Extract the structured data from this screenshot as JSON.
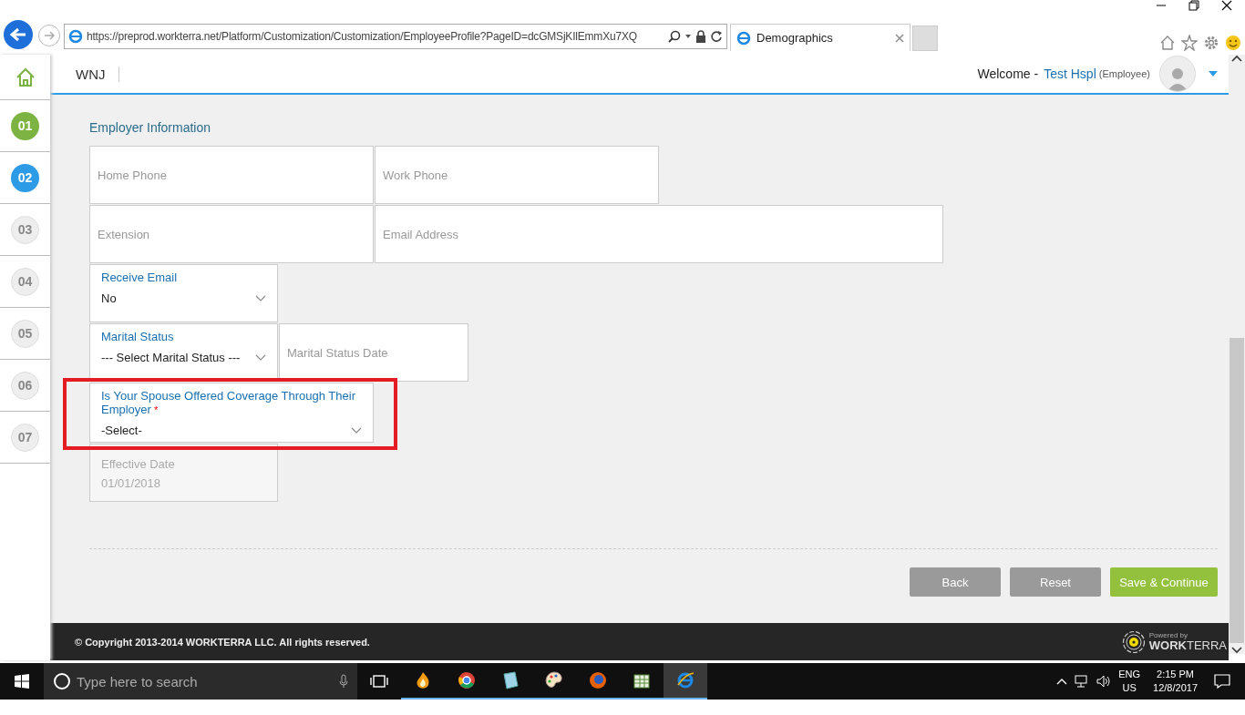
{
  "browser": {
    "address": "https://preprod.workterra.net/Platform/Customization/Customization/EmployeeProfile?PageID=dcGMSjKIlEmmXu7XQ",
    "tab_title": "Demographics"
  },
  "header": {
    "brand": "WNJ",
    "welcome": "Welcome -",
    "user": "Test Hspl",
    "role": "(Employee)"
  },
  "steps": [
    {
      "label": "01",
      "completed": true,
      "selected": false
    },
    {
      "label": "02",
      "completed": false,
      "selected": true
    },
    {
      "label": "03",
      "completed": false,
      "selected": false
    },
    {
      "label": "04",
      "completed": false,
      "selected": false
    },
    {
      "label": "05",
      "completed": false,
      "selected": false
    },
    {
      "label": "06",
      "completed": false,
      "selected": false
    },
    {
      "label": "07",
      "completed": false,
      "selected": false
    }
  ],
  "section_title": "Employer Information",
  "rows": [
    [
      {
        "kind": "input",
        "placeholder": "Home Phone"
      },
      {
        "kind": "input",
        "placeholder": "Work Phone"
      }
    ],
    [
      {
        "kind": "input",
        "placeholder": "Extension"
      },
      {
        "kind": "input",
        "placeholder": "Email Address"
      }
    ],
    [
      {
        "kind": "select",
        "label": "Receive Email",
        "value": "No"
      }
    ],
    [
      {
        "kind": "select",
        "label": "Marital Status",
        "value": "--- Select Marital Status ---"
      },
      {
        "kind": "input",
        "placeholder": "Marital Status Date"
      }
    ],
    [
      {
        "kind": "select",
        "label": "Is Your Spouse Offered Coverage Through Their Employer",
        "required_mark": "*",
        "value": "-Select-",
        "highlighted": true
      }
    ],
    [
      {
        "kind": "readonly",
        "label": "Effective Date",
        "value": "01/01/2018",
        "disabled": true
      }
    ]
  ],
  "buttons": [
    {
      "label": "Back",
      "kind": "secondary"
    },
    {
      "label": "Reset",
      "kind": "secondary"
    },
    {
      "label": "Save & Continue",
      "kind": "primary"
    }
  ],
  "footer": {
    "copyright": "© Copyright 2013-2014 WORKTERRA LLC. All rights reserved.",
    "powered_by": "Powered by",
    "brand_bold": "WORK",
    "brand_light": "TERRA"
  },
  "taskbar": {
    "search_placeholder": "Type here to search",
    "apps": [
      {
        "kind": "flame",
        "selected": false
      },
      {
        "kind": "chrome",
        "selected": false
      },
      {
        "kind": "book",
        "selected": false
      },
      {
        "kind": "palette",
        "selected": false
      },
      {
        "kind": "firefox",
        "selected": false
      },
      {
        "kind": "sheet",
        "selected": false
      },
      {
        "kind": "ie",
        "selected": true
      }
    ],
    "language": "ENG",
    "region": "US",
    "time": "2:15 PM",
    "date": "12/8/2017"
  }
}
